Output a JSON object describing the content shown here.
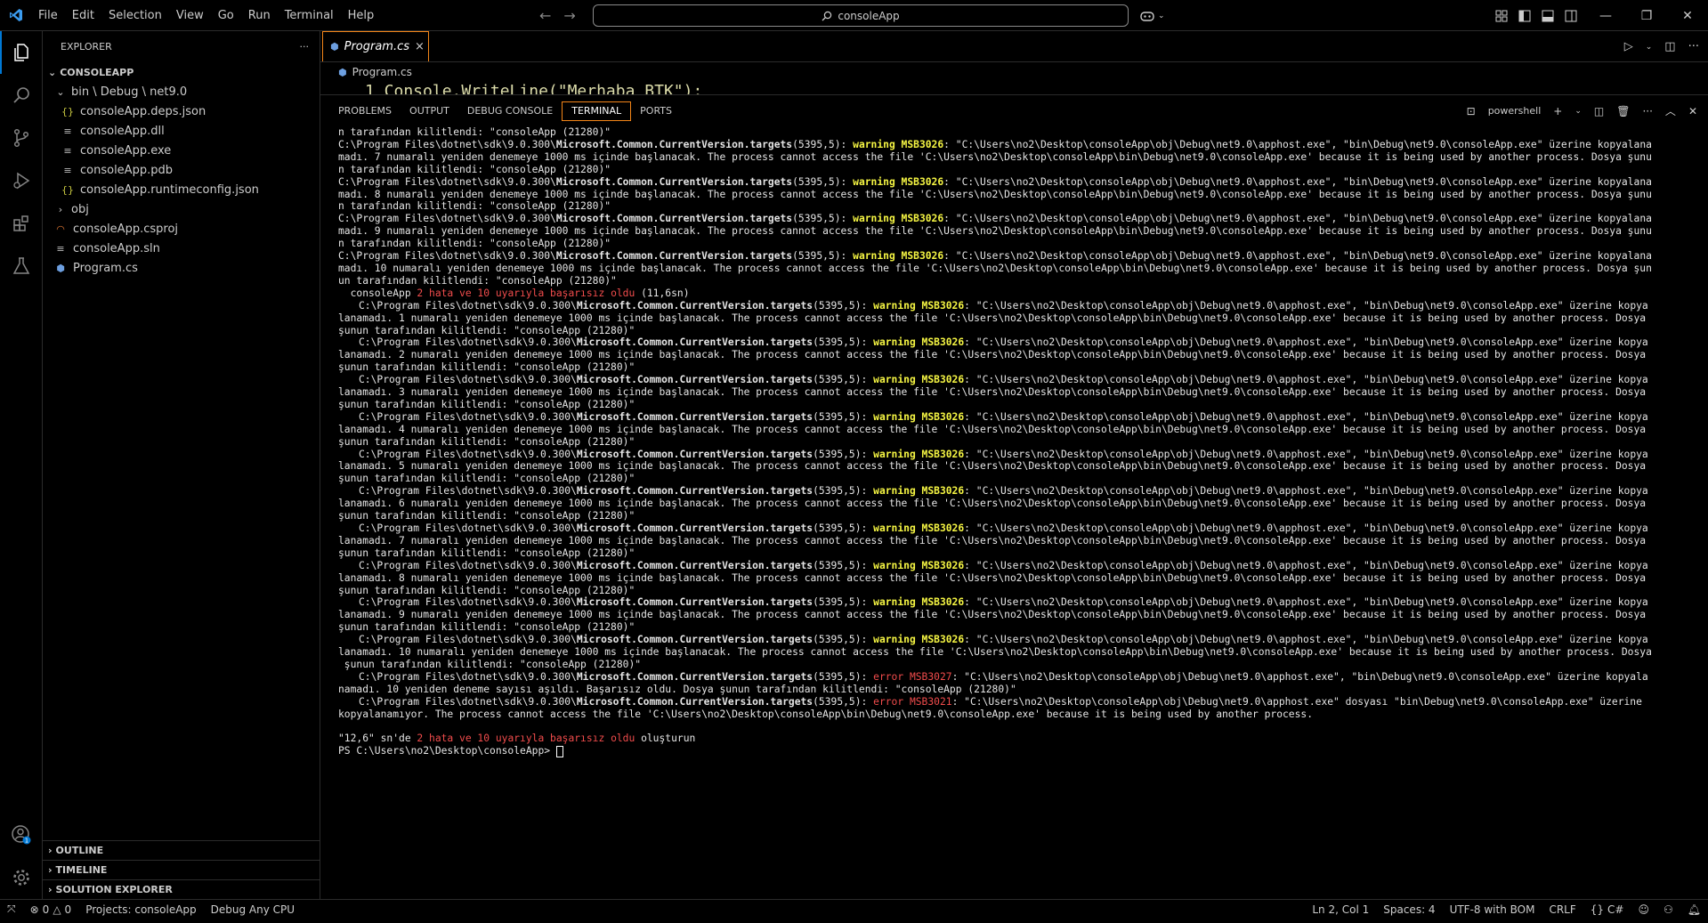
{
  "menu": [
    "File",
    "Edit",
    "Selection",
    "View",
    "Go",
    "Run",
    "Terminal",
    "Help"
  ],
  "search": {
    "text": "consoleApp"
  },
  "sidebar": {
    "title": "EXPLORER",
    "more": "···",
    "root": "CONSOLEAPP",
    "items": [
      {
        "label": "bin \\ Debug \\ net9.0",
        "icon": "chevron-down",
        "depth": 1
      },
      {
        "label": "consoleApp.deps.json",
        "icon": "json-icon",
        "depth": 2
      },
      {
        "label": "consoleApp.dll",
        "icon": "lines-icon",
        "depth": 2
      },
      {
        "label": "consoleApp.exe",
        "icon": "lines-icon",
        "depth": 2
      },
      {
        "label": "consoleApp.pdb",
        "icon": "lines-icon",
        "depth": 2
      },
      {
        "label": "consoleApp.runtimeconfig.json",
        "icon": "json-icon",
        "depth": 2
      },
      {
        "label": "obj",
        "icon": "chevron-right",
        "depth": 1
      },
      {
        "label": "consoleApp.csproj",
        "icon": "rss-icon",
        "depth": 1
      },
      {
        "label": "consoleApp.sln",
        "icon": "lines-icon",
        "depth": 1
      },
      {
        "label": "Program.cs",
        "icon": "csharp-icon",
        "depth": 1
      }
    ],
    "bottom_sections": [
      "OUTLINE",
      "TIMELINE",
      "SOLUTION EXPLORER"
    ]
  },
  "editor": {
    "tab_label": "Program.cs",
    "tab_close": "×",
    "breadcrumb": "Program.cs",
    "code_peek": "1    Console.WriteLine(\"Merhaba BTK\");"
  },
  "panel": {
    "tabs": [
      "PROBLEMS",
      "OUTPUT",
      "DEBUG CONSOLE",
      "TERMINAL",
      "PORTS"
    ],
    "active_tab": "TERMINAL",
    "shell": "powershell"
  },
  "terminal": {
    "path": "C:\\Program Files\\dotnet\\sdk\\9.0.300\\",
    "targets": "Microsoft.Common.CurrentVersion.targets",
    "loc": "(5395,5): ",
    "warn": "warning MSB3026",
    "copy_tail": ": \"C:\\Users\\no2\\Desktop\\consoleApp\\obj\\Debug\\net9.0\\apphost.exe\", \"bin\\Debug\\net9.0\\consoleApp.exe\" üzerine kopyalana",
    "copy_tail_indent": ": \"C:\\Users\\no2\\Desktop\\consoleApp\\obj\\Debug\\net9.0\\apphost.exe\", \"bin\\Debug\\net9.0\\consoleApp.exe\" üzerine kopya",
    "line0": "n tarafından kilitlendi: \"consoleApp (21280)\"",
    "retries_top": [
      {
        "mid": "madı. 7 numaralı yeniden denemeye 1000 ms içinde başlanacak. The process cannot access the file 'C:\\Users\\no2\\Desktop\\consoleApp\\bin\\Debug\\net9.0\\consoleApp.exe' because it is being used by another process. Dosya şunu",
        "end": "n tarafından kilitlendi: \"consoleApp (21280)\""
      },
      {
        "mid": "madı. 8 numaralı yeniden denemeye 1000 ms içinde başlanacak. The process cannot access the file 'C:\\Users\\no2\\Desktop\\consoleApp\\bin\\Debug\\net9.0\\consoleApp.exe' because it is being used by another process. Dosya şunu",
        "end": "n tarafından kilitlendi: \"consoleApp (21280)\""
      },
      {
        "mid": "madı. 9 numaralı yeniden denemeye 1000 ms içinde başlanacak. The process cannot access the file 'C:\\Users\\no2\\Desktop\\consoleApp\\bin\\Debug\\net9.0\\consoleApp.exe' because it is being used by another process. Dosya şunu",
        "end": "n tarafından kilitlendi: \"consoleApp (21280)\""
      },
      {
        "mid": "madı. 10 numaralı yeniden denemeye 1000 ms içinde başlanacak. The process cannot access the file 'C:\\Users\\no2\\Desktop\\consoleApp\\bin\\Debug\\net9.0\\consoleApp.exe' because it is being used by another process. Dosya şun",
        "end": "un tarafından kilitlendi: \"consoleApp (21280)\""
      }
    ],
    "summary_project": "  consoleApp ",
    "summary_fail": "2 hata ve 10 uyarıyla başarısız oldu",
    "summary_time": " (11,6sn)",
    "retries_indent": [
      {
        "mid": "lanamadı. 1 numaralı yeniden denemeye 1000 ms içinde başlanacak. The process cannot access the file 'C:\\Users\\no2\\Desktop\\consoleApp\\bin\\Debug\\net9.0\\consoleApp.exe' because it is being used by another process. Dosya",
        "end": "şunun tarafından kilitlendi: \"consoleApp (21280)\""
      },
      {
        "mid": "lanamadı. 2 numaralı yeniden denemeye 1000 ms içinde başlanacak. The process cannot access the file 'C:\\Users\\no2\\Desktop\\consoleApp\\bin\\Debug\\net9.0\\consoleApp.exe' because it is being used by another process. Dosya",
        "end": "şunun tarafından kilitlendi: \"consoleApp (21280)\""
      },
      {
        "mid": "lanamadı. 3 numaralı yeniden denemeye 1000 ms içinde başlanacak. The process cannot access the file 'C:\\Users\\no2\\Desktop\\consoleApp\\bin\\Debug\\net9.0\\consoleApp.exe' because it is being used by another process. Dosya",
        "end": "şunun tarafından kilitlendi: \"consoleApp (21280)\""
      },
      {
        "mid": "lanamadı. 4 numaralı yeniden denemeye 1000 ms içinde başlanacak. The process cannot access the file 'C:\\Users\\no2\\Desktop\\consoleApp\\bin\\Debug\\net9.0\\consoleApp.exe' because it is being used by another process. Dosya",
        "end": "şunun tarafından kilitlendi: \"consoleApp (21280)\""
      },
      {
        "mid": "lanamadı. 5 numaralı yeniden denemeye 1000 ms içinde başlanacak. The process cannot access the file 'C:\\Users\\no2\\Desktop\\consoleApp\\bin\\Debug\\net9.0\\consoleApp.exe' because it is being used by another process. Dosya",
        "end": "şunun tarafından kilitlendi: \"consoleApp (21280)\""
      },
      {
        "mid": "lanamadı. 6 numaralı yeniden denemeye 1000 ms içinde başlanacak. The process cannot access the file 'C:\\Users\\no2\\Desktop\\consoleApp\\bin\\Debug\\net9.0\\consoleApp.exe' because it is being used by another process. Dosya",
        "end": "şunun tarafından kilitlendi: \"consoleApp (21280)\""
      },
      {
        "mid": "lanamadı. 7 numaralı yeniden denemeye 1000 ms içinde başlanacak. The process cannot access the file 'C:\\Users\\no2\\Desktop\\consoleApp\\bin\\Debug\\net9.0\\consoleApp.exe' because it is being used by another process. Dosya",
        "end": "şunun tarafından kilitlendi: \"consoleApp (21280)\""
      },
      {
        "mid": "lanamadı. 8 numaralı yeniden denemeye 1000 ms içinde başlanacak. The process cannot access the file 'C:\\Users\\no2\\Desktop\\consoleApp\\bin\\Debug\\net9.0\\consoleApp.exe' because it is being used by another process. Dosya",
        "end": "şunun tarafından kilitlendi: \"consoleApp (21280)\""
      },
      {
        "mid": "lanamadı. 9 numaralı yeniden denemeye 1000 ms içinde başlanacak. The process cannot access the file 'C:\\Users\\no2\\Desktop\\consoleApp\\bin\\Debug\\net9.0\\consoleApp.exe' because it is being used by another process. Dosya",
        "end": "şunun tarafından kilitlendi: \"consoleApp (21280)\""
      },
      {
        "mid": "lanamadı. 10 numaralı yeniden denemeye 1000 ms içinde başlanacak. The process cannot access the file 'C:\\Users\\no2\\Desktop\\consoleApp\\bin\\Debug\\net9.0\\consoleApp.exe' because it is being used by another process. Dosya",
        "end": " şunun tarafından kilitlendi: \"consoleApp (21280)\""
      }
    ],
    "err1_code": "error MSB3027",
    "err1_tail": ": \"C:\\Users\\no2\\Desktop\\consoleApp\\obj\\Debug\\net9.0\\apphost.exe\", \"bin\\Debug\\net9.0\\consoleApp.exe\" üzerine kopyala",
    "err1_cont": "namadı. 10 yeniden deneme sayısı aşıldı. Başarısız oldu. Dosya şunun tarafından kilitlendi: \"consoleApp (21280)\"",
    "err2_code": "error MSB3021",
    "err2_tail": ": \"C:\\Users\\no2\\Desktop\\consoleApp\\obj\\Debug\\net9.0\\apphost.exe\" dosyası \"bin\\Debug\\net9.0\\consoleApp.exe\" üzerine",
    "err2_cont": "kopyalanamıyor. The process cannot access the file 'C:\\Users\\no2\\Desktop\\consoleApp\\bin\\Debug\\net9.0\\consoleApp.exe' because it is being used by another process.",
    "final_pre": "\"12,6\" sn'de ",
    "final_fail": "2 hata ve 10 uyarıyla başarısız oldu",
    "final_post": " oluşturun",
    "prompt": "PS C:\\Users\\no2\\Desktop\\consoleApp> "
  },
  "statusbar": {
    "remote": "⤧",
    "errors": "0",
    "warnings": "0",
    "projects": "Projects: consoleApp",
    "config": "Debug Any CPU",
    "position": "Ln 2, Col 1",
    "spaces": "Spaces: 4",
    "encoding": "UTF-8 with BOM",
    "eol": "CRLF",
    "language": "C#"
  },
  "colors": {
    "accent": "#0078d4",
    "focus_border": "#f38518",
    "warning": "#f5f543",
    "error": "#f14c4c"
  }
}
